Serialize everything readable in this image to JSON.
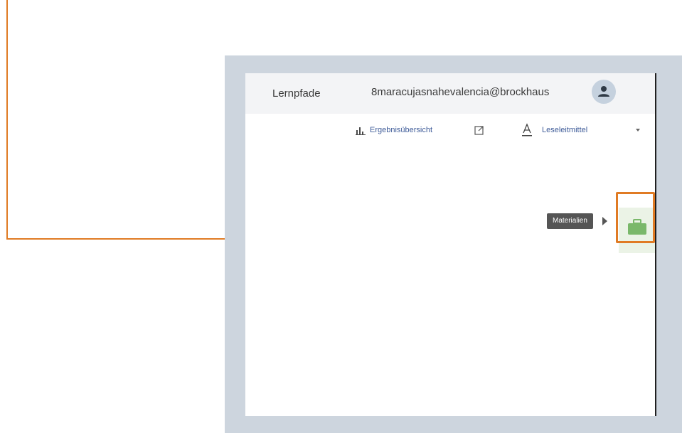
{
  "header": {
    "nav_link": "Lernpfade",
    "user_email": "8maracujasnahevalencia@brockhaus",
    "avatar_icon": "user-icon"
  },
  "toolbar": {
    "results_icon": "bar-chart-icon",
    "results_label": "Ergebnisübersicht",
    "external_icon": "external-link-icon",
    "font_icon": "font-a-icon",
    "font_select_value": "Leseleitmittel",
    "caret_icon": "caret-down-icon"
  },
  "materials": {
    "tooltip": "Materialien",
    "icon": "briefcase-icon",
    "accent_color": "#7ab86a"
  },
  "callout": {
    "color": "#e07b24"
  }
}
